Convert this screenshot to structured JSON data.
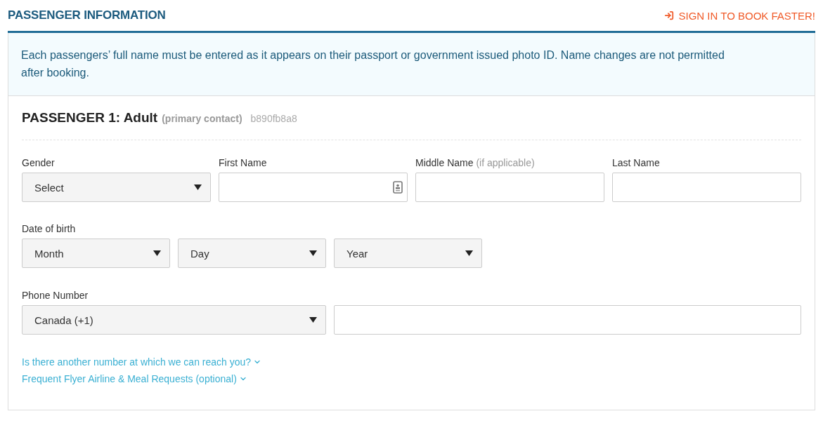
{
  "header": {
    "title": "PASSENGER INFORMATION",
    "sign_in": "SIGN IN TO BOOK FASTER!"
  },
  "notice": "Each passengers’ full name must be entered as it appears on their passport or government issued photo ID. Name changes are not permitted after booking.",
  "passenger": {
    "title": "PASSENGER 1: Adult",
    "role": "(primary contact)",
    "code": "b890fb8a8"
  },
  "name_fields": [
    {
      "kind": "select",
      "label": "Gender",
      "value": "Select"
    },
    {
      "kind": "text",
      "label": "First Name",
      "autofill_icon": true
    },
    {
      "kind": "text",
      "label": "Middle Name",
      "hint": "(if applicable)",
      "autofill_icon": false
    },
    {
      "kind": "text",
      "label": "Last Name",
      "autofill_icon": false
    }
  ],
  "date_of_birth": {
    "label": "Date of birth",
    "selects": [
      {
        "value": "Month"
      },
      {
        "value": "Day"
      },
      {
        "value": "Year"
      }
    ]
  },
  "phone": {
    "label": "Phone Number",
    "country": "Canada (+1)"
  },
  "links": [
    "Is there another number at which we can reach you?",
    "Frequent Flyer Airline & Meal Requests (optional)"
  ]
}
